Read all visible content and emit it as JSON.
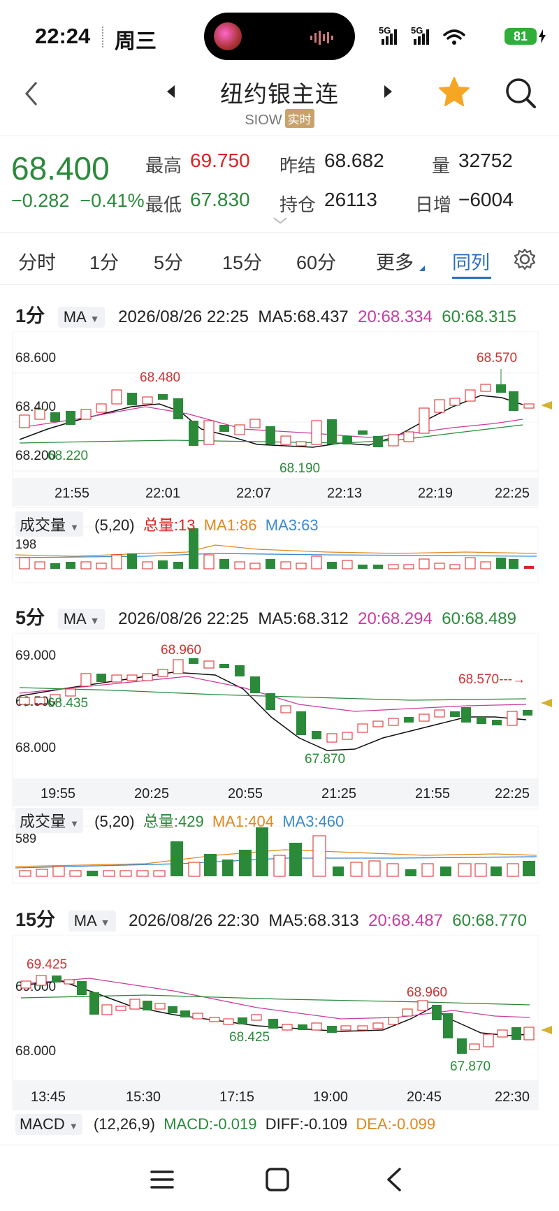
{
  "status_bar": {
    "time": "22:24",
    "weekday": "周三",
    "battery": "81",
    "network_labels": [
      "5G",
      "5G"
    ]
  },
  "header": {
    "title": "纽约银主连",
    "symbol": "SIOW",
    "tag": "实时"
  },
  "quote": {
    "last": "68.400",
    "change": "−0.282",
    "change_pct": "−0.41%",
    "high_label": "最高",
    "high": "69.750",
    "low_label": "最低",
    "low": "67.830",
    "prev_label": "昨结",
    "prev": "68.682",
    "oi_label": "持仓",
    "oi": "26113",
    "vol_label": "量",
    "vol": "32752",
    "daily_label": "日增",
    "daily": "−6004"
  },
  "tabs": [
    "分时",
    "1分",
    "5分",
    "15分",
    "60分",
    "更多",
    "同列"
  ],
  "active_tab": "同列",
  "panels": [
    {
      "period": "1分",
      "indicator": "MA",
      "datetime": "2026/08/26 22:25",
      "ma5": "MA5:68.437",
      "ma20": "20:68.334",
      "ma60": "60:68.315",
      "y_ticks": [
        "68.600",
        "68.400",
        "68.200"
      ],
      "x_ticks": [
        "21:55",
        "22:01",
        "22:07",
        "22:13",
        "22:19",
        "22:25"
      ],
      "annotations": [
        "68.480",
        "68.220",
        "68.190",
        "68.570"
      ],
      "vol_selector": "成交量",
      "vol_param": "(5,20)",
      "vol_total": "总量:13",
      "vol_ma1": "MA1:86",
      "vol_ma3": "MA3:63",
      "vol_tick": "198"
    },
    {
      "period": "5分",
      "indicator": "MA",
      "datetime": "2026/08/26 22:25",
      "ma5": "MA5:68.312",
      "ma20": "20:68.294",
      "ma60": "60:68.489",
      "y_ticks": [
        "69.000",
        "68.500",
        "68.000"
      ],
      "x_ticks": [
        "19:55",
        "20:25",
        "20:55",
        "21:25",
        "21:55",
        "22:25"
      ],
      "annotations": [
        "68.960",
        "←---68.435",
        "67.870",
        "68.570---→"
      ],
      "vol_selector": "成交量",
      "vol_param": "(5,20)",
      "vol_total": "总量:429",
      "vol_ma1": "MA1:404",
      "vol_ma3": "MA3:460",
      "vol_tick": "589"
    },
    {
      "period": "15分",
      "indicator": "MA",
      "datetime": "2026/08/26 22:30",
      "ma5": "MA5:68.313",
      "ma20": "20:68.487",
      "ma60": "60:68.770",
      "y_ticks": [
        "69.000",
        "68.000"
      ],
      "x_ticks": [
        "13:45",
        "15:30",
        "17:15",
        "19:00",
        "20:45",
        "22:30"
      ],
      "annotations": [
        "69.425",
        "68.425",
        "68.960",
        "67.870"
      ],
      "macd_selector": "MACD",
      "macd_param": "(12,26,9)",
      "macd": "MACD:-0.019",
      "diff": "DIFF:-0.109",
      "dea": "DEA:-0.099"
    }
  ],
  "colors": {
    "up": "#d22",
    "down": "#2a8a3a",
    "active": "#2b6fc0",
    "star": "#f5a623"
  }
}
